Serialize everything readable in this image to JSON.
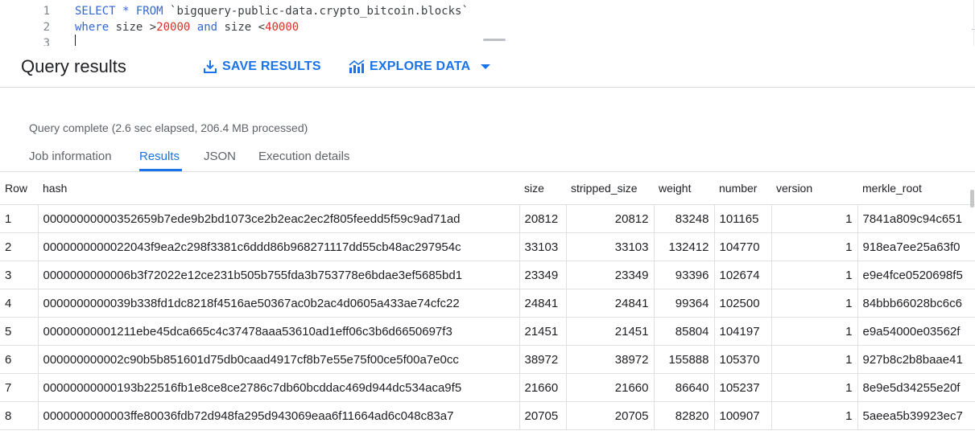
{
  "editor": {
    "lines": [
      {
        "no": "1",
        "parts": [
          {
            "t": "SELECT * FROM ",
            "c": "kw"
          },
          {
            "t": "`bigquery-public-data.crypto_bitcoin.blocks`",
            "c": "str"
          }
        ]
      },
      {
        "no": "2",
        "parts": [
          {
            "t": "where",
            "c": "kw"
          },
          {
            "t": " size >",
            "c": "plain"
          },
          {
            "t": "20000",
            "c": "num"
          },
          {
            "t": " ",
            "c": "plain"
          },
          {
            "t": "and",
            "c": "kw"
          },
          {
            "t": " size <",
            "c": "plain"
          },
          {
            "t": "40000",
            "c": "num"
          }
        ]
      },
      {
        "no": "3",
        "parts": []
      }
    ]
  },
  "results": {
    "title": "Query results",
    "save_label": "SAVE RESULTS",
    "explore_label": "EXPLORE DATA"
  },
  "status": "Query complete (2.6 sec elapsed, 206.4 MB processed)",
  "tabs": [
    {
      "label": "Job information",
      "active": false
    },
    {
      "label": "Results",
      "active": true
    },
    {
      "label": "JSON",
      "active": false
    },
    {
      "label": "Execution details",
      "active": false
    }
  ],
  "table": {
    "columns": [
      "Row",
      "hash",
      "size",
      "stripped_size",
      "weight",
      "number",
      "version",
      "merkle_root"
    ],
    "rows": [
      [
        "1",
        "00000000000352659b7ede9b2bd1073ce2b2eac2ec2f805feedd5f59c9ad71ad",
        "20812",
        "20812",
        "83248",
        "101165",
        "1",
        "7841a809c94c651"
      ],
      [
        "2",
        "0000000000022043f9ea2c298f3381c6ddd86b968271117dd55cb48ac297954c",
        "33103",
        "33103",
        "132412",
        "104770",
        "1",
        "918ea7ee25a63f0"
      ],
      [
        "3",
        "0000000000006b3f72022e12ce231b505b755fda3b753778e6bdae3ef5685bd1",
        "23349",
        "23349",
        "93396",
        "102674",
        "1",
        "e9e4fce0520698f5"
      ],
      [
        "4",
        "0000000000039b338fd1dc8218f4516ae50367ac0b2ac4d0605a433ae74cfc22",
        "24841",
        "24841",
        "99364",
        "102500",
        "1",
        "84bbb66028bc6c6"
      ],
      [
        "5",
        "00000000001211ebe45dca665c4c37478aaa53610ad1eff06c3b6d6650697f3",
        "21451",
        "21451",
        "85804",
        "104197",
        "1",
        "e9a54000e03562f"
      ],
      [
        "6",
        "000000000002c90b5b851601d75db0caad4917cf8b7e55e75f00ce5f00a7e0cc",
        "38972",
        "38972",
        "155888",
        "105370",
        "1",
        "927b8c2b8baae41"
      ],
      [
        "7",
        "00000000000193b22516fb1e8ce8ce2786c7db60bcddac469d944dc534aca9f5",
        "21660",
        "21660",
        "86640",
        "105237",
        "1",
        "8e9e5d34255e20f"
      ],
      [
        "8",
        "0000000000003ffe80036fdb72d948fa295d943069eaa6f11664ad6c048c83a7",
        "20705",
        "20705",
        "82820",
        "100907",
        "1",
        "5aeea5b39923ec7"
      ]
    ]
  },
  "colors": {
    "accent": "#1a73e8",
    "keyword": "#3367d6",
    "number": "#d93025"
  }
}
